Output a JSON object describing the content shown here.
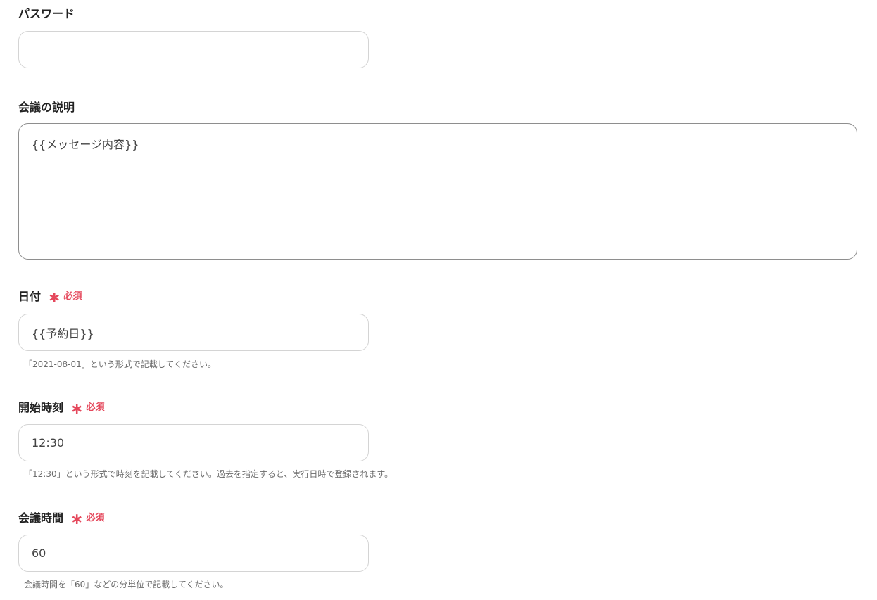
{
  "password": {
    "label": "パスワード",
    "value": ""
  },
  "description": {
    "label": "会議の説明",
    "value": "{{メッセージ内容}}"
  },
  "date": {
    "label": "日付",
    "required": "必須",
    "value": "{{予約日}}",
    "hint": "「2021-08-01」という形式で記載してください。"
  },
  "start_time": {
    "label": "開始時刻",
    "required": "必須",
    "value": "12:30",
    "hint": "「12:30」という形式で時刻を記載してください。過去を指定すると、実行日時で登録されます。"
  },
  "duration": {
    "label": "会議時間",
    "required": "必須",
    "value": "60",
    "hint": "会議時間を「60」などの分単位で記載してください。"
  },
  "colors": {
    "required_accent": "#e5485c",
    "input_border": "#d4d4d4",
    "textarea_border": "#8e8e8e",
    "label_text": "#222222",
    "hint_text": "#6b6b6b"
  },
  "icons": {
    "required_marker": "asterisk-icon"
  }
}
